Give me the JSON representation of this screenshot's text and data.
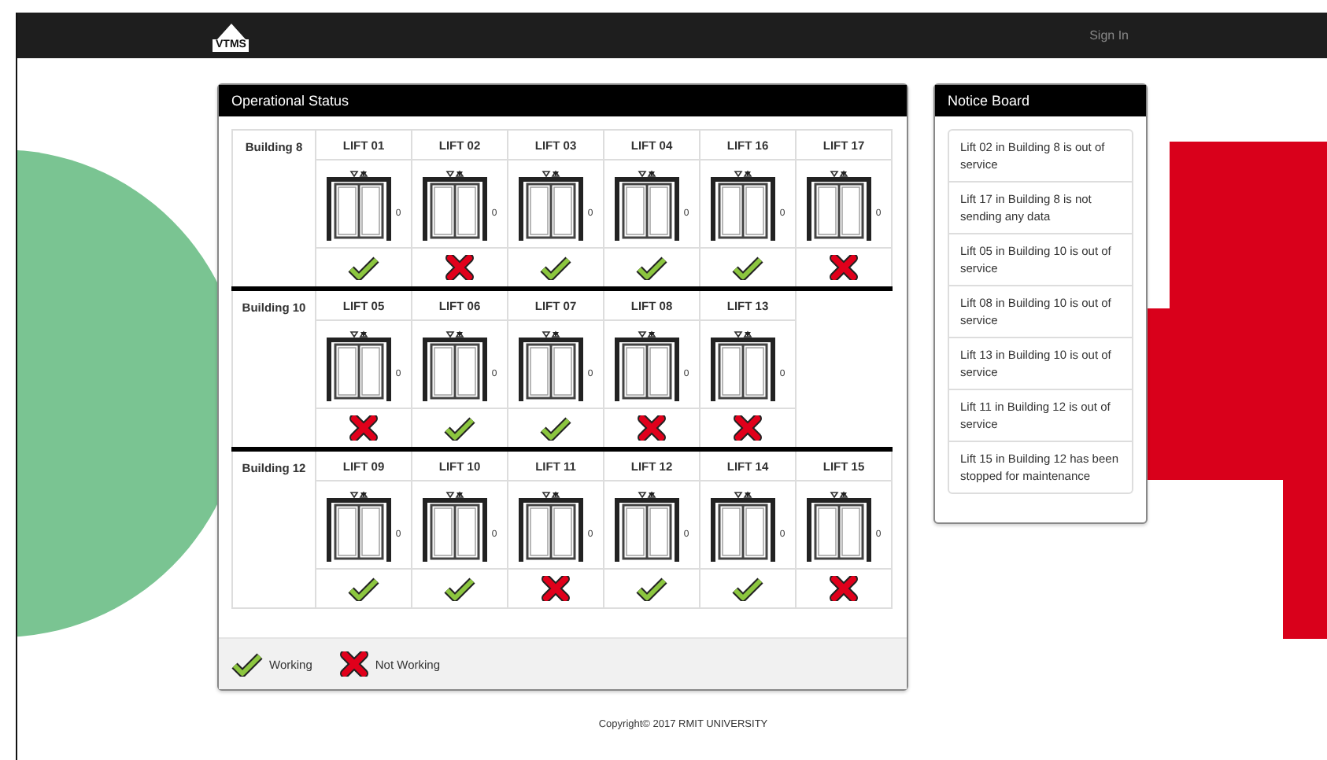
{
  "navbar": {
    "logo": "VTMS",
    "sign_in": "Sign In"
  },
  "status_panel": {
    "title": "Operational Status",
    "buildings": [
      {
        "name": "Building 8",
        "lifts": [
          {
            "name": "LIFT 01",
            "floor": "0",
            "working": true
          },
          {
            "name": "LIFT 02",
            "floor": "0",
            "working": false
          },
          {
            "name": "LIFT 03",
            "floor": "0",
            "working": true
          },
          {
            "name": "LIFT 04",
            "floor": "0",
            "working": true
          },
          {
            "name": "LIFT 16",
            "floor": "0",
            "working": true
          },
          {
            "name": "LIFT 17",
            "floor": "0",
            "working": false
          }
        ]
      },
      {
        "name": "Building 10",
        "lifts": [
          {
            "name": "LIFT 05",
            "floor": "0",
            "working": false
          },
          {
            "name": "LIFT 06",
            "floor": "0",
            "working": true
          },
          {
            "name": "LIFT 07",
            "floor": "0",
            "working": true
          },
          {
            "name": "LIFT 08",
            "floor": "0",
            "working": false
          },
          {
            "name": "LIFT 13",
            "floor": "0",
            "working": false
          }
        ]
      },
      {
        "name": "Building 12",
        "lifts": [
          {
            "name": "LIFT 09",
            "floor": "0",
            "working": true
          },
          {
            "name": "LIFT 10",
            "floor": "0",
            "working": true
          },
          {
            "name": "LIFT 11",
            "floor": "0",
            "working": false
          },
          {
            "name": "LIFT 12",
            "floor": "0",
            "working": true
          },
          {
            "name": "LIFT 14",
            "floor": "0",
            "working": true
          },
          {
            "name": "LIFT 15",
            "floor": "0",
            "working": false
          }
        ]
      }
    ],
    "legend": [
      {
        "label": "Working",
        "working": true
      },
      {
        "label": "Not Working",
        "working": false
      }
    ]
  },
  "notice_board": {
    "title": "Notice Board",
    "notices": [
      "Lift 02 in Building 8 is out of service",
      "Lift 17 in Building 8 is not sending any data",
      "Lift 05 in Building 10 is out of service",
      "Lift 08 in Building 10 is out of service",
      "Lift 13 in Building 10 is out of service",
      "Lift 11 in Building 12 is out of service",
      "Lift 15 in Building 12 has been stopped for maintenance"
    ]
  },
  "footer": "Copyright© 2017 RMIT UNIVERSITY"
}
